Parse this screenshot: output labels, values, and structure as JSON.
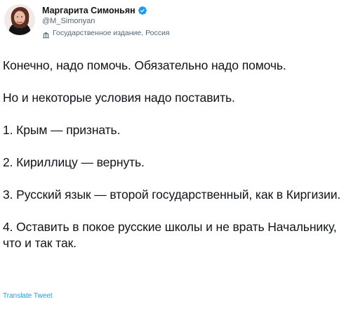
{
  "tweet": {
    "author": {
      "display_name": "Маргарита Симоньян",
      "handle": "@M_Simonyan",
      "verified_icon": "verified-badge-icon",
      "label_icon": "state-media-icon",
      "label": "Государственное издание, Россия"
    },
    "paragraphs": [
      "Конечно, надо помочь. Обязательно надо помочь.",
      "Но и некоторые условия надо поставить.",
      "1. Крым — признать.",
      "2. Кириллицу — вернуть.",
      "3. Русский язык — второй государственный, как в Киргизии.",
      "4. Оставить в покое русские школы и не врать Начальнику, что и так так."
    ],
    "translate_link": "Translate Tweet"
  },
  "colors": {
    "text": "#0f1419",
    "secondary": "#536471",
    "link": "#1d9bf0",
    "verified": "#1d9bf0"
  }
}
